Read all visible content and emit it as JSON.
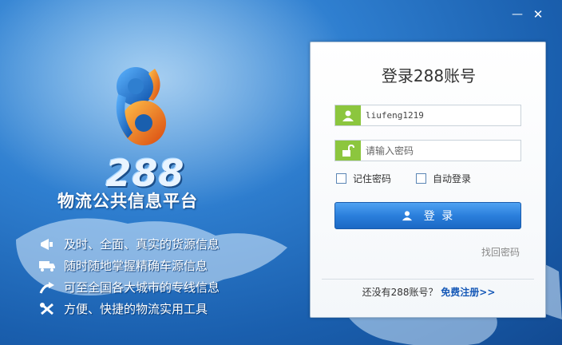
{
  "window": {
    "minimize_glyph": "—",
    "close_glyph": "✕"
  },
  "brand": {
    "logo_number": "288",
    "tagline": "物流公共信息平台",
    "colors": {
      "blue": "#1f7fd8",
      "orange": "#f07a1a",
      "background": "#2f7fd0"
    }
  },
  "features": [
    {
      "icon": "megaphone-icon",
      "text": "及时、全面、真实的货源信息"
    },
    {
      "icon": "truck-icon",
      "text": "随时随地掌握精确车源信息"
    },
    {
      "icon": "arrow-route-icon",
      "text": "可至全国各大城市的专线信息"
    },
    {
      "icon": "tools-icon",
      "text": "方便、快捷的物流实用工具"
    }
  ],
  "login": {
    "title": "登录288账号",
    "username_value": "liufeng1219",
    "password_placeholder": "请输入密码",
    "remember_label": "记住密码",
    "auto_login_label": "自动登录",
    "login_button_label": "登 录",
    "forgot_link": "找回密码",
    "register_prompt": "还没有288账号？",
    "register_link": "免费注册>>",
    "accent_color": "#2b7fdc",
    "icon_bg_color": "#8cc63e"
  }
}
